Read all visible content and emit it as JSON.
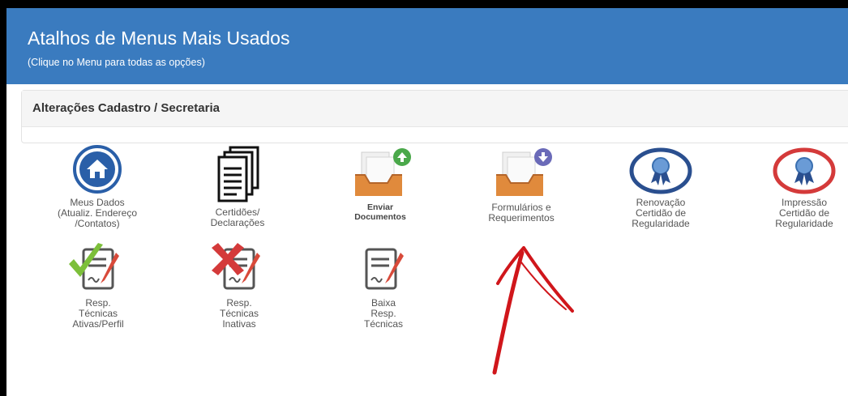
{
  "header": {
    "title": "Atalhos de Menus Mais Usados",
    "subtitle": "(Clique no Menu para todas as opções)"
  },
  "section": {
    "title": "Alterações Cadastro / Secretaria"
  },
  "tiles": [
    {
      "label": "Meus Dados\n(Atualiz. Endereço\n/Contatos)",
      "icon": "home-icon"
    },
    {
      "label": "Certidões/\nDeclarações",
      "icon": "documents-icon"
    },
    {
      "label": "Enviar\nDocumentos",
      "icon": "upload-tray-icon"
    },
    {
      "label": "Formulários e\nRequerimentos",
      "icon": "download-tray-icon"
    },
    {
      "label": "Renovação\nCertidão de\nRegularidade",
      "icon": "ribbon-badge-icon"
    },
    {
      "label": "Impressão\nCertidão de\nRegularidade",
      "icon": "ribbon-badge-red-icon"
    },
    {
      "label": "Resp.\nTécnicas\nAtivas/Perfil",
      "icon": "signed-doc-check-icon"
    },
    {
      "label": "Resp.\nTécnicas\nInativas",
      "icon": "signed-doc-x-icon"
    },
    {
      "label": "Baixa\nResp.\nTécnicas",
      "icon": "signed-doc-icon"
    }
  ],
  "annotation": {
    "icon": "red-arrow-icon",
    "color": "#d0161b"
  },
  "colors": {
    "header_bg": "#3a7bbf",
    "home_blue": "#2a5fa8",
    "tray_orange": "#e08a3c",
    "badge_red": "#d43a3a"
  }
}
